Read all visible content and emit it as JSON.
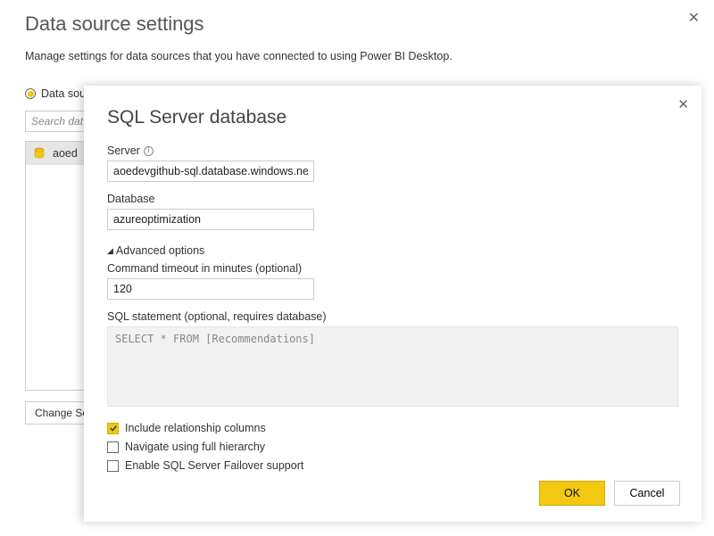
{
  "outer": {
    "title": "Data source settings",
    "description": "Manage settings for data sources that you have connected to using Power BI Desktop.",
    "radio_label": "Data sou",
    "search_placeholder": "Search dat",
    "source_item": "aoed",
    "change_source_btn": "Change So"
  },
  "modal": {
    "title": "SQL Server database",
    "server_label": "Server",
    "server_value": "aoedevgithub-sql.database.windows.net",
    "database_label": "Database",
    "database_value": "azureoptimization",
    "advanced_label": "Advanced options",
    "timeout_label": "Command timeout in minutes (optional)",
    "timeout_value": "120",
    "sql_label": "SQL statement (optional, requires database)",
    "sql_value": "SELECT * FROM [Recommendations]",
    "chk_relationship": "Include relationship columns",
    "chk_hierarchy": "Navigate using full hierarchy",
    "chk_failover": "Enable SQL Server Failover support",
    "ok": "OK",
    "cancel": "Cancel"
  }
}
